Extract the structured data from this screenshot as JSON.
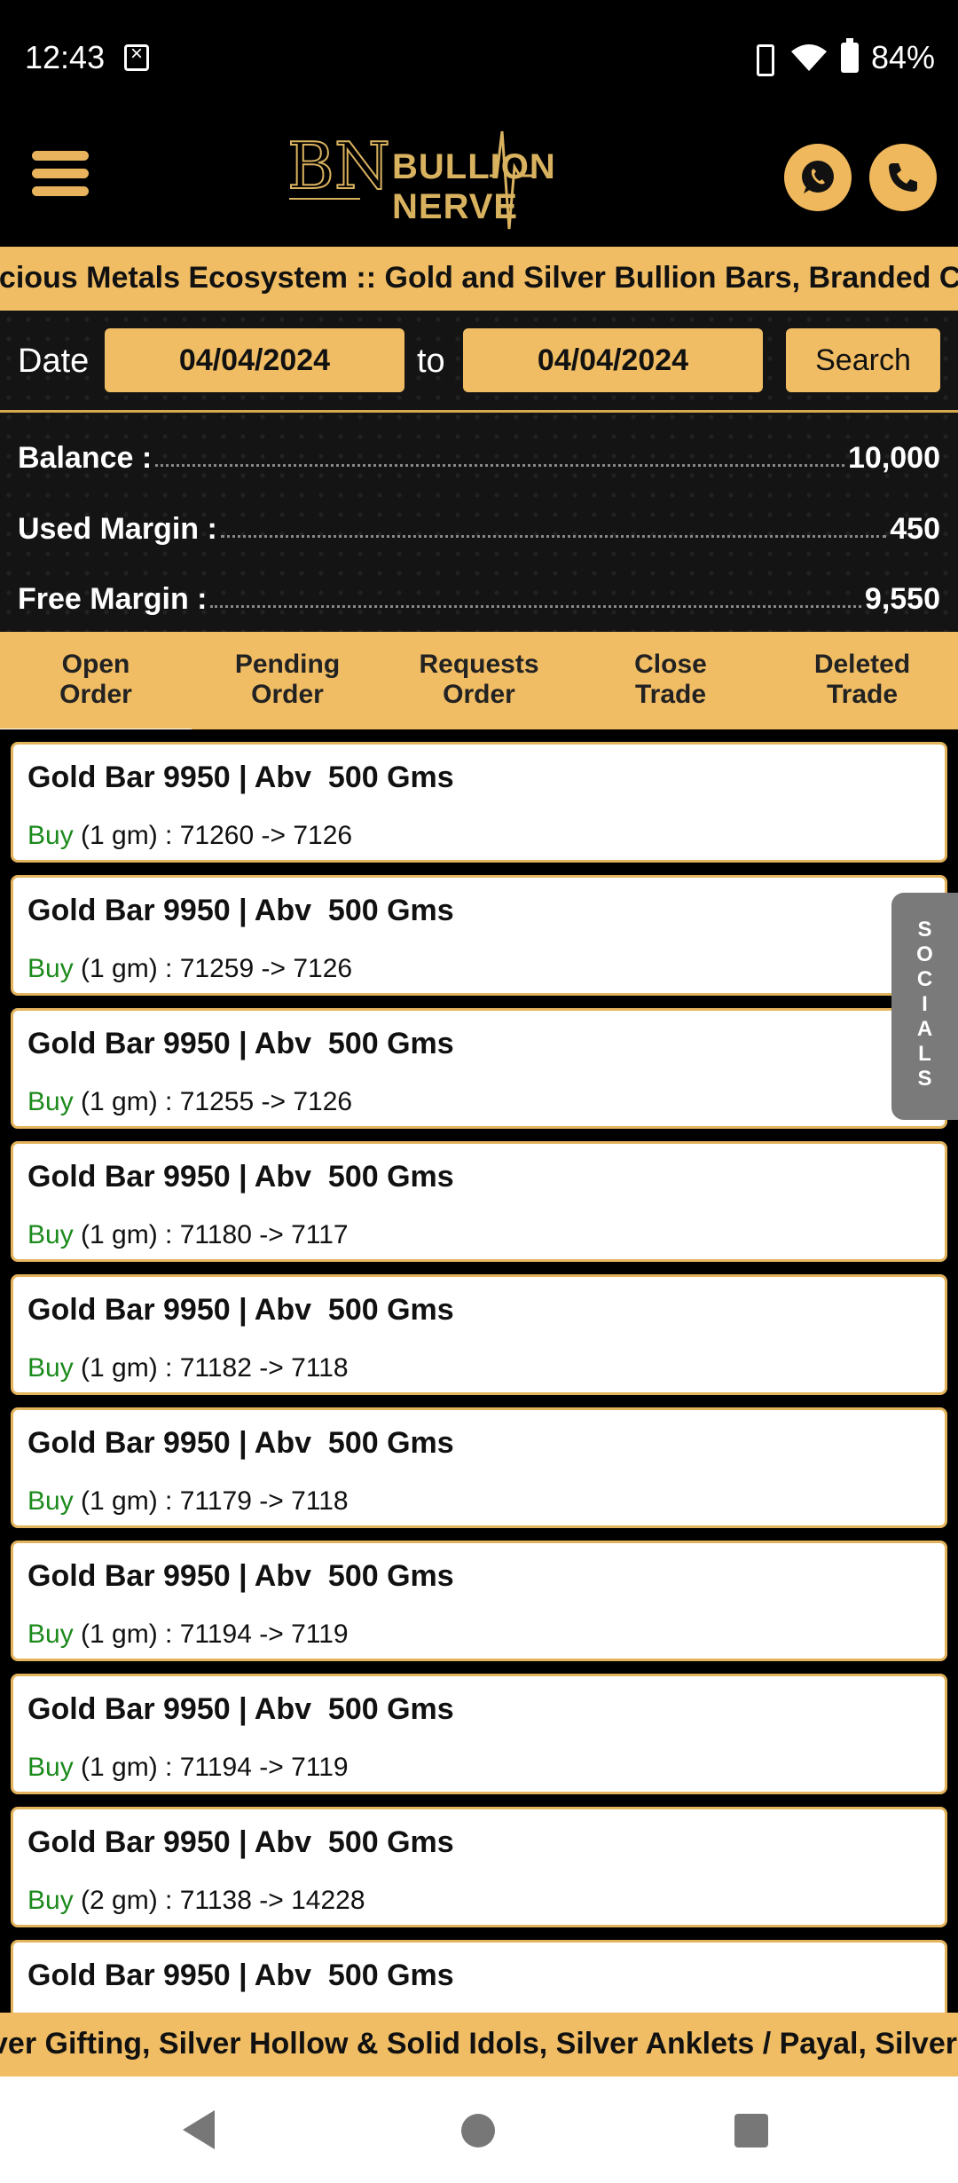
{
  "status_bar": {
    "time": "12:43",
    "battery": "84%"
  },
  "header": {
    "brand": "BULLION NERVE"
  },
  "ticker_top": "ecious Metals Ecosystem :: Gold and Silver Bullion Bars, Branded Co",
  "date_filter": {
    "label": "Date",
    "from": "04/04/2024",
    "to_label": "to",
    "to": "04/04/2024",
    "search_label": "Search"
  },
  "summary": [
    {
      "label": "Balance :",
      "value": "10,000"
    },
    {
      "label": "Used Margin :",
      "value": "450"
    },
    {
      "label": "Free Margin :",
      "value": "9,550"
    }
  ],
  "tabs": [
    {
      "line1": "Open",
      "line2": "Order",
      "active": true
    },
    {
      "line1": "Pending",
      "line2": "Order",
      "active": false
    },
    {
      "line1": "Requests",
      "line2": "Order",
      "active": false
    },
    {
      "line1": "Close",
      "line2": "Trade",
      "active": false
    },
    {
      "line1": "Deleted",
      "line2": "Trade",
      "active": false
    }
  ],
  "orders": [
    {
      "title": "Gold Bar 9950 | Abv  500 Gms",
      "side": "Buy",
      "detail": " (1 gm) : 71260 -> 7126"
    },
    {
      "title": "Gold Bar 9950 | Abv  500 Gms",
      "side": "Buy",
      "detail": " (1 gm) : 71259 -> 7126"
    },
    {
      "title": "Gold Bar 9950 | Abv  500 Gms",
      "side": "Buy",
      "detail": " (1 gm) : 71255 -> 7126"
    },
    {
      "title": "Gold Bar 9950 | Abv  500 Gms",
      "side": "Buy",
      "detail": " (1 gm) : 71180 -> 7117"
    },
    {
      "title": "Gold Bar 9950 | Abv  500 Gms",
      "side": "Buy",
      "detail": " (1 gm) : 71182 -> 7118"
    },
    {
      "title": "Gold Bar 9950 | Abv  500 Gms",
      "side": "Buy",
      "detail": " (1 gm) : 71179 -> 7118"
    },
    {
      "title": "Gold Bar 9950 | Abv  500 Gms",
      "side": "Buy",
      "detail": " (1 gm) : 71194 -> 7119"
    },
    {
      "title": "Gold Bar 9950 | Abv  500 Gms",
      "side": "Buy",
      "detail": " (1 gm) : 71194 -> 7119"
    },
    {
      "title": "Gold Bar 9950 | Abv  500 Gms",
      "side": "Buy",
      "detail": " (2 gm) : 71138 -> 14228"
    },
    {
      "title": "Gold Bar 9950 | Abv  500 Gms",
      "side": "",
      "detail": ""
    }
  ],
  "socials_label": [
    "S",
    "O",
    "C",
    "I",
    "A",
    "L",
    "S"
  ],
  "ticker_bottom": "ver Gifting, Silver Hollow & Solid Idols, Silver Anklets / Payal, Silver",
  "colors": {
    "gold": "#f0bd64",
    "buy": "#1c8a1c"
  }
}
